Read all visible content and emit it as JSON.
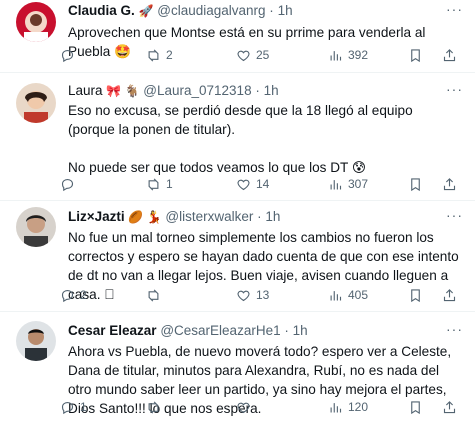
{
  "tweets": [
    {
      "name": "Claudia G.",
      "name_emoji": "🚀",
      "handle": "@claudiagalvanrg",
      "separator": "·",
      "time": "1h",
      "text": "Aprovechen que Montse está en su prrime para venderla al Puebla 🤩",
      "replies": "",
      "retweets": "2",
      "likes": "25",
      "views": "392",
      "avatar_color": "#c8102e"
    },
    {
      "name": "Laura",
      "name_emoji": "🎀 🐐",
      "handle": "@Laura_0712318",
      "separator": "·",
      "time": "1h",
      "text": "Eso no excusa, se perdió desde que la 18 llegó al equipo (porque la ponen de titular).\n\nNo puede ser que todos veamos lo que los DT 😰",
      "replies": "",
      "retweets": "1",
      "likes": "14",
      "views": "307",
      "avatar_color": "#e2c2a8"
    },
    {
      "name": "Liz×Jazti",
      "name_emoji": "🏉 💃",
      "handle": "@listerxwalker",
      "separator": "·",
      "time": "1h",
      "text": "No fue un mal torneo simplemente los cambios no fueron los correctos y espero se hayan dado cuenta de que con ese intento de dt no van a llegar lejos. Buen viaje, avisen cuando lleguen a casa. 🏻",
      "replies": "2",
      "retweets": "",
      "likes": "13",
      "views": "405",
      "avatar_color": "#3a3a3a"
    },
    {
      "name": "Cesar Eleazar",
      "name_emoji": "",
      "handle": "@CesarEleazarHe1",
      "separator": "·",
      "time": "1h",
      "text": "Ahora vs Puebla, de nuevo moverá todo? espero ver a Celeste, Dana de titular, minutos para Alexandra, Rubí, no es nada del otro mundo saber leer un partido, ya sino hay mejora el partes, Dios Santo!!! lo que nos espera.",
      "replies": "1",
      "retweets": "",
      "likes": "",
      "views": "120",
      "avatar_color": "#2b3238"
    }
  ]
}
